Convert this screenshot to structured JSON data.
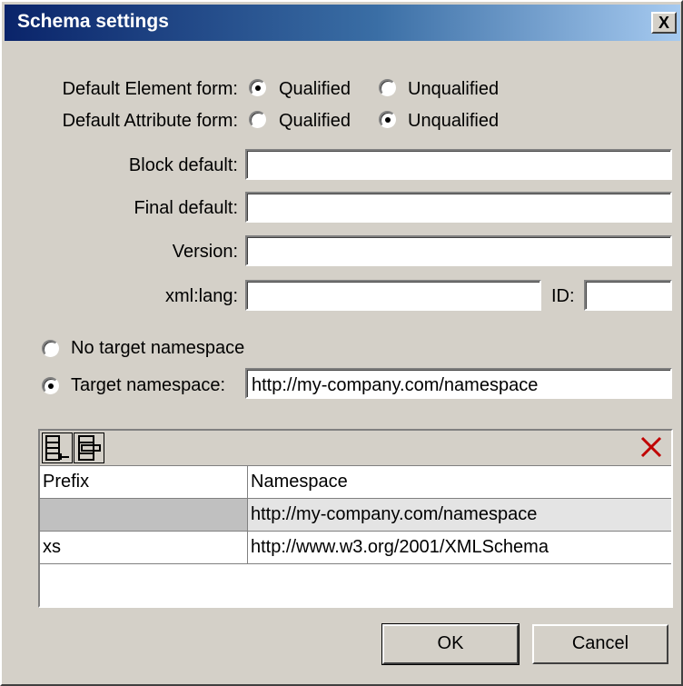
{
  "dialog": {
    "title": "Schema settings",
    "close_label": "X"
  },
  "element_form": {
    "label": "Default Element form:",
    "options": [
      "Qualified",
      "Unqualified"
    ],
    "selected": "Qualified"
  },
  "attribute_form": {
    "label": "Default Attribute form:",
    "options": [
      "Qualified",
      "Unqualified"
    ],
    "selected": "Unqualified"
  },
  "block_default": {
    "label": "Block default:",
    "value": ""
  },
  "final_default": {
    "label": "Final default:",
    "value": ""
  },
  "version": {
    "label": "Version:",
    "value": ""
  },
  "xml_lang": {
    "label": "xml:lang:",
    "value": ""
  },
  "id": {
    "label": "ID:",
    "value": ""
  },
  "namespace_mode": {
    "no_target_label": "No target namespace",
    "target_label": "Target namespace:",
    "selected": "target",
    "target_value": "http://my-company.com/namespace"
  },
  "namespace_table": {
    "headers": {
      "prefix": "Prefix",
      "namespace": "Namespace"
    },
    "rows": [
      {
        "prefix": "",
        "namespace": "http://my-company.com/namespace"
      },
      {
        "prefix": "xs",
        "namespace": "http://www.w3.org/2001/XMLSchema"
      }
    ],
    "icons": [
      "append-row-icon",
      "insert-row-icon",
      "delete-row-icon"
    ]
  },
  "buttons": {
    "ok": "OK",
    "cancel": "Cancel"
  }
}
